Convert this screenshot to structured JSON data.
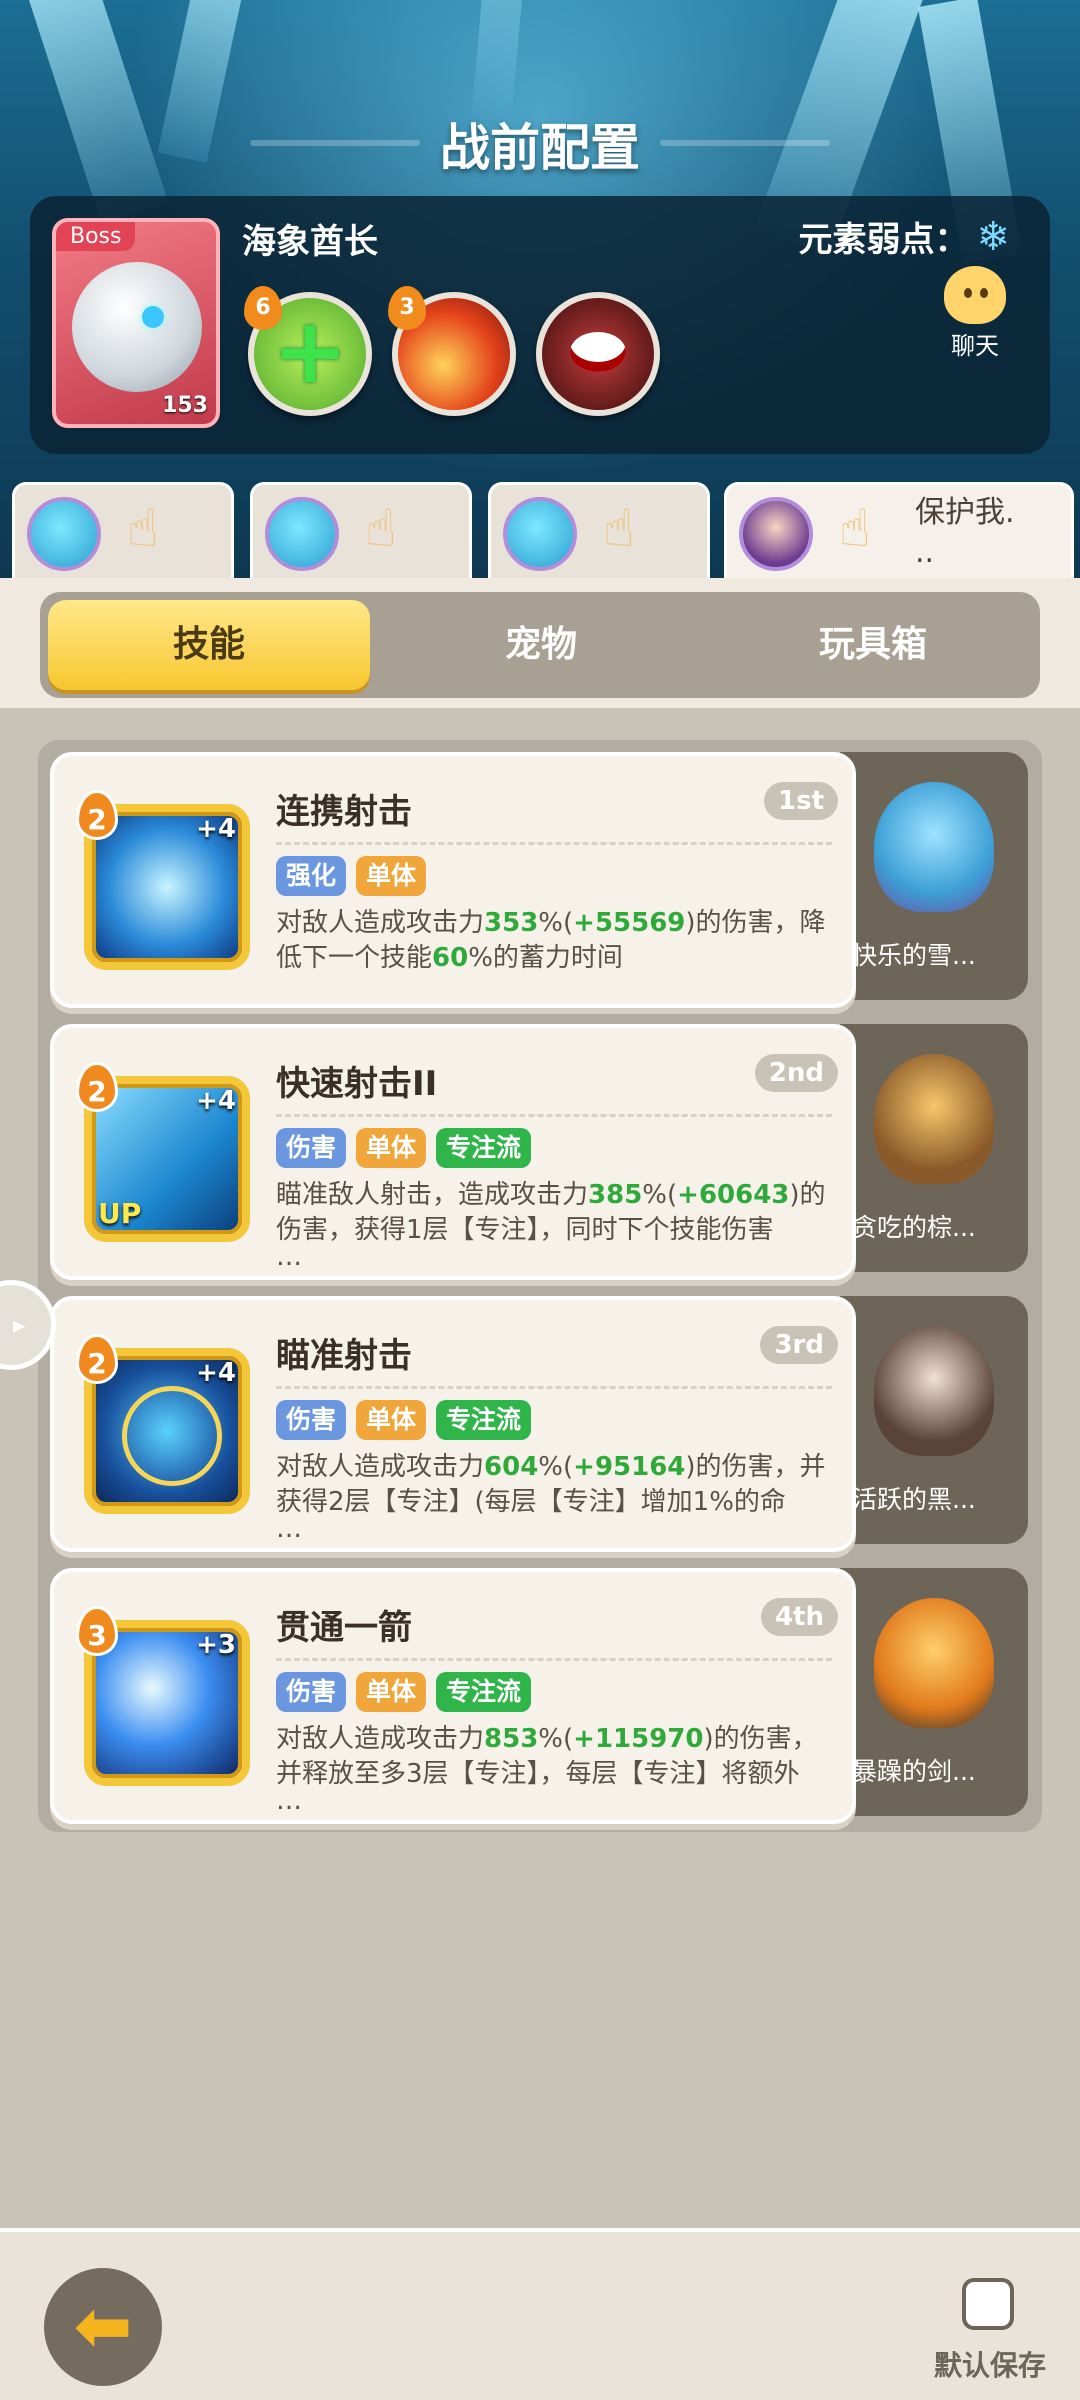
{
  "header": {
    "title": "战前配置"
  },
  "boss": {
    "tag": "Boss",
    "name": "海象酋长",
    "level": "153",
    "element_weakness_label": "元素弱点：",
    "element_weakness_icon": "snowflake-icon",
    "skills": [
      {
        "badge": "6",
        "icon": "heal-plus-icon"
      },
      {
        "badge": "3",
        "icon": "fire-slash-icon"
      },
      {
        "badge": "",
        "icon": "monster-maw-icon"
      }
    ]
  },
  "chat": {
    "label": "聊天"
  },
  "team": {
    "slot4_text": "保护我.\n.."
  },
  "tabs": [
    "技能",
    "宠物",
    "玩具箱"
  ],
  "skills": [
    {
      "level": "2",
      "plus": "+4",
      "up": "",
      "name": "连携射击",
      "order": "1st",
      "tags": [
        "强化",
        "单体"
      ],
      "desc_parts": [
        "对敌人造成攻击力",
        "353",
        "%(",
        "+55569",
        ")的伤害，降低下一个技能",
        "60",
        "%的蓄力时间"
      ],
      "pet_name": "快乐的雪..."
    },
    {
      "level": "2",
      "plus": "+4",
      "up": "UP",
      "name": "快速射击II",
      "order": "2nd",
      "tags": [
        "伤害",
        "单体",
        "专注流"
      ],
      "desc_parts": [
        "瞄准敌人射击，造成攻击力",
        "385",
        "%(",
        "+60643",
        ")的伤害，获得1层【专注】，同时下个技能伤害",
        "",
        "…"
      ],
      "pet_name": "贪吃的棕..."
    },
    {
      "level": "2",
      "plus": "+4",
      "up": "",
      "name": "瞄准射击",
      "order": "3rd",
      "tags": [
        "伤害",
        "单体",
        "专注流"
      ],
      "desc_parts": [
        "对敌人造成攻击力",
        "604",
        "%(",
        "+95164",
        ")的伤害，并获得2层【专注】(每层【专注】增加1%的命",
        "",
        "…"
      ],
      "pet_name": "活跃的黑..."
    },
    {
      "level": "3",
      "plus": "+3",
      "up": "",
      "name": "贯通一箭",
      "order": "4th",
      "tags": [
        "伤害",
        "单体",
        "专注流"
      ],
      "desc_parts": [
        "对敌人造成攻击力",
        "853",
        "%(",
        "+115970",
        ")的伤害，并释放至多3层【专注】，每层【专注】将额外",
        "",
        "…"
      ],
      "pet_name": "暴躁的剑..."
    }
  ],
  "footer": {
    "back_icon": "back-arrow-icon",
    "save_label": "默认保存"
  },
  "colors": {
    "tab_active": "#f8c730",
    "tag_blue": "#6b97e0",
    "tag_orange": "#f0a63a",
    "tag_green": "#30b54b",
    "highlight_green": "#2faa3a"
  }
}
